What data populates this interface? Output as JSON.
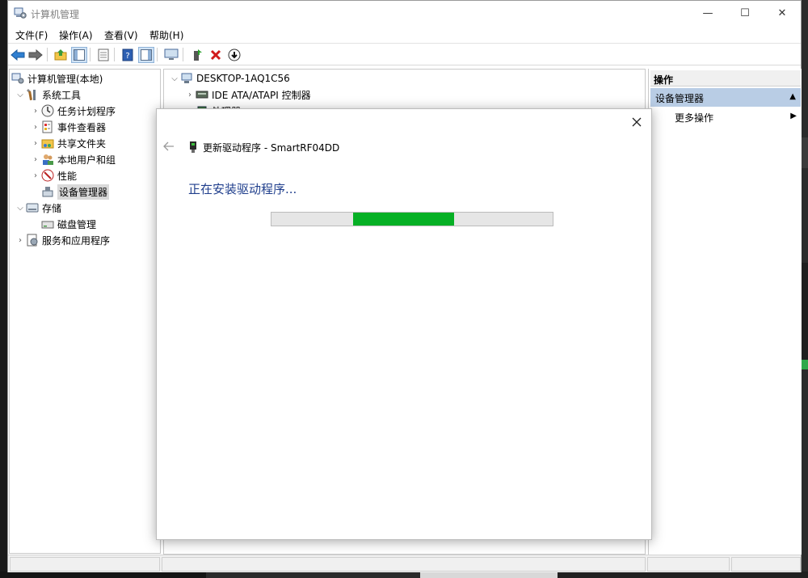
{
  "window": {
    "title": "计算机管理",
    "controls": {
      "minimize": "—",
      "maximize": "☐",
      "close": "✕"
    }
  },
  "menu": [
    "文件(F)",
    "操作(A)",
    "查看(V)",
    "帮助(H)"
  ],
  "tree": {
    "root": "计算机管理(本地)",
    "items": [
      {
        "label": "系统工具",
        "expanded": true
      },
      {
        "label": "任务计划程序"
      },
      {
        "label": "事件查看器"
      },
      {
        "label": "共享文件夹"
      },
      {
        "label": "本地用户和组"
      },
      {
        "label": "性能"
      },
      {
        "label": "设备管理器",
        "selected": true
      },
      {
        "label": "存储",
        "expanded": true
      },
      {
        "label": "磁盘管理"
      },
      {
        "label": "服务和应用程序"
      }
    ]
  },
  "devices": {
    "computer": "DESKTOP-1AQ1C56",
    "items": [
      "IDE ATA/ATAPI 控制器",
      "处理器"
    ]
  },
  "actions": {
    "header": "操作",
    "section": "设备管理器",
    "more": "更多操作"
  },
  "dialog": {
    "title": "更新驱动程序 - SmartRF04DD",
    "heading": "正在安装驱动程序...",
    "progress_start": 0.29,
    "progress_end": 0.65,
    "progress_color": "#06b025"
  },
  "colors": {
    "accent": "#1f3e8c",
    "selection": "#b9cde5"
  }
}
